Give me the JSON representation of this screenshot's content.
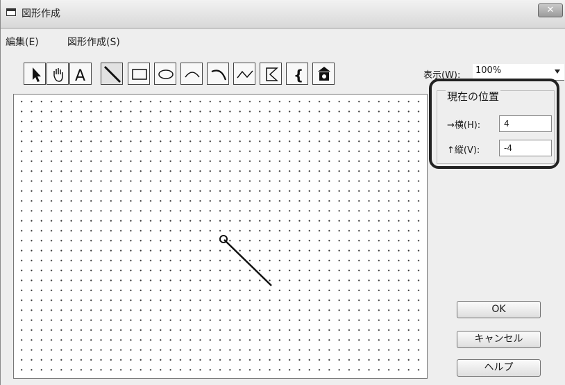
{
  "window": {
    "title": "図形作成",
    "close_glyph": "✕"
  },
  "menu": [
    {
      "label": "編集(E)"
    },
    {
      "label": "図形作成(S)"
    }
  ],
  "toolbar": {
    "tools": [
      {
        "name": "select-arrow-tool-icon"
      },
      {
        "name": "hand-tool-icon"
      },
      {
        "name": "text-tool-icon",
        "glyph": "A"
      },
      {
        "name": "line-tool-icon",
        "active": true
      },
      {
        "name": "rectangle-tool-icon"
      },
      {
        "name": "ellipse-tool-icon"
      },
      {
        "name": "arc-tool-icon"
      },
      {
        "name": "curve-tool-icon"
      },
      {
        "name": "polyline-tool-icon"
      },
      {
        "name": "polygon-tool-icon"
      },
      {
        "name": "brace-tool-icon",
        "glyph": "{"
      },
      {
        "name": "stamp-tool-icon"
      }
    ]
  },
  "zoom": {
    "label": "表示(W):",
    "value": "100%"
  },
  "position": {
    "title": "現在の位置",
    "horizontal_label": "→横(H):",
    "horizontal_value": "4",
    "vertical_label": "↑縦(V):",
    "vertical_value": "-4"
  },
  "buttons": {
    "ok": "OK",
    "cancel": "キャンセル",
    "help": "ヘルプ"
  }
}
